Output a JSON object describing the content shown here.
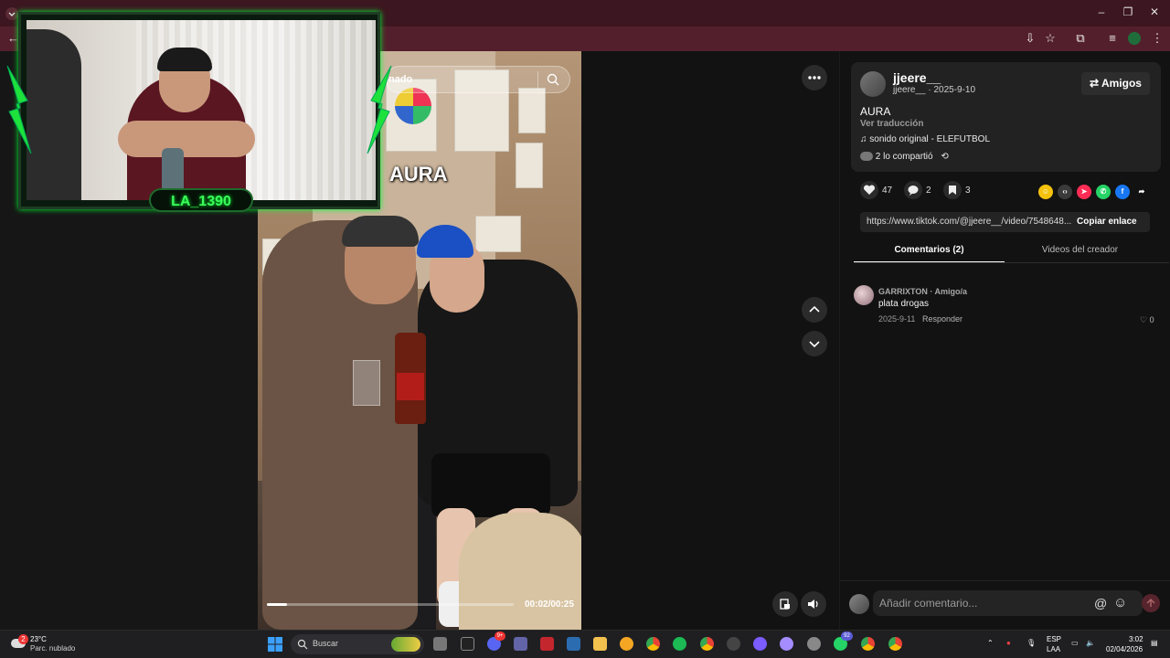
{
  "video": {
    "overlay_title": "AURA",
    "search_text": "nado",
    "time": "00:02/00:25",
    "progress_fraction": 0.08
  },
  "cam": {
    "name": "LA_1390"
  },
  "post": {
    "username": "jjeere__",
    "userline": "jjeere__ · 2025-9-10",
    "friends_label": "Amigos",
    "description": "AURA",
    "translate": "Ver traducción",
    "sound": "sonido original - ELEFUTBOL",
    "shared": "2 lo compartió"
  },
  "stats": {
    "likes": "47",
    "comments": "2",
    "saves": "3"
  },
  "link": {
    "url": "https://www.tiktok.com/@jjeere__/video/7548648...",
    "copy_label": "Copiar enlace"
  },
  "tabs": {
    "comments": "Comentarios (2)",
    "videos": "Videos del creador"
  },
  "comment": {
    "author": "GARRIXTON · Amigo/a",
    "text": "plata drogas",
    "date": "2025-9-11",
    "reply": "Responder",
    "likes": "0"
  },
  "comment_bar": {
    "placeholder": "Añadir comentario..."
  },
  "taskbar": {
    "weather_temp": "23°C",
    "weather_desc": "Parc. nublado",
    "weather_badge": "2",
    "search_label": "Buscar",
    "lang_top": "ESP",
    "lang_bottom": "LAA",
    "time": "3:02",
    "date": "02/04/2026",
    "discord_badge": "9+",
    "messenger_badge": "92"
  },
  "colors": {
    "accent_green": "#3cff5a",
    "tab_bar": "#3c1620",
    "toolbar": "#531f2c"
  }
}
